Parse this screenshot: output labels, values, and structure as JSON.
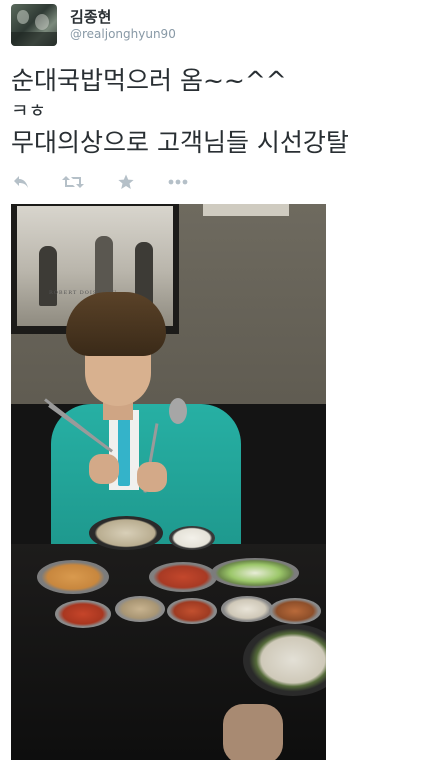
{
  "tweet": {
    "display_name": "김종현",
    "handle": "@realjonghyun90",
    "lines": [
      "순대국밥먹으러 옴~~^^",
      "ㅋㅎ",
      "무대의상으로 고객님들 시선강탈"
    ]
  },
  "actions": [
    {
      "name": "reply",
      "icon": "reply-icon"
    },
    {
      "name": "retweet",
      "icon": "retweet-icon"
    },
    {
      "name": "favorite",
      "icon": "star-icon"
    },
    {
      "name": "more",
      "icon": "more-icon"
    }
  ],
  "photo": {
    "poster_caption": "ROBERT DOISNEAU"
  },
  "colors": {
    "text": "#292f33",
    "muted": "#8899a6",
    "action_icon": "#b5c0c8",
    "jacket": "#27b0a4"
  }
}
